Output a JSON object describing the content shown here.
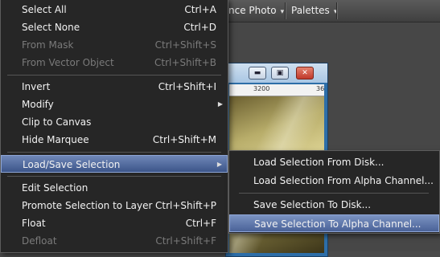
{
  "toolbar": {
    "items": [
      {
        "label": "nce Photo"
      },
      {
        "label": "Palettes"
      }
    ]
  },
  "image_window": {
    "buttons": [
      "minimize",
      "restore",
      "close"
    ],
    "ruler_labels": [
      "3200",
      "36"
    ]
  },
  "main_menu": {
    "items": [
      {
        "label": "Select All",
        "shortcut": "Ctrl+A",
        "enabled": true
      },
      {
        "label": "Select None",
        "shortcut": "Ctrl+D",
        "enabled": true
      },
      {
        "label": "From Mask",
        "shortcut": "Ctrl+Shift+S",
        "enabled": false
      },
      {
        "label": "From Vector Object",
        "shortcut": "Ctrl+Shift+B",
        "enabled": false
      },
      {
        "label": "Invert",
        "shortcut": "Ctrl+Shift+I",
        "enabled": true
      },
      {
        "label": "Modify",
        "shortcut": "",
        "enabled": true,
        "submenu": true
      },
      {
        "label": "Clip to Canvas",
        "shortcut": "",
        "enabled": true
      },
      {
        "label": "Hide Marquee",
        "shortcut": "Ctrl+Shift+M",
        "enabled": true
      },
      {
        "label": "Load/Save Selection",
        "shortcut": "",
        "enabled": true,
        "submenu": true,
        "highlighted": true
      },
      {
        "label": "Edit Selection",
        "shortcut": "",
        "enabled": true
      },
      {
        "label": "Promote Selection to Layer",
        "shortcut": "Ctrl+Shift+P",
        "enabled": true
      },
      {
        "label": "Float",
        "shortcut": "Ctrl+F",
        "enabled": true
      },
      {
        "label": "Defloat",
        "shortcut": "Ctrl+Shift+F",
        "enabled": false
      }
    ]
  },
  "sub_menu": {
    "items": [
      {
        "label": "Load Selection From Disk..."
      },
      {
        "label": "Load Selection From Alpha Channel..."
      },
      {
        "label": "Save Selection To Disk..."
      },
      {
        "label": "Save Selection To Alpha Channel...",
        "highlighted": true
      }
    ]
  },
  "colors": {
    "menu_bg": "#262626",
    "highlight": "#4a6298",
    "disabled_text": "#7a7a7a"
  }
}
